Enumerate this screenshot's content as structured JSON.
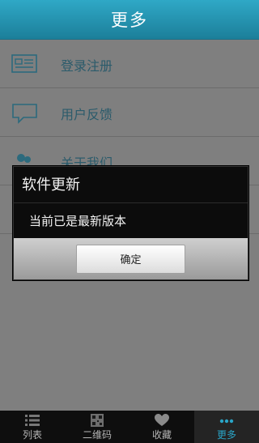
{
  "header": {
    "title": "更多"
  },
  "list": [
    {
      "label": "登录注册",
      "icon": "id-card-icon"
    },
    {
      "label": "用户反馈",
      "icon": "chat-bubble-icon"
    },
    {
      "label": "关于我们",
      "icon": "users-icon"
    },
    {
      "label": "",
      "icon": "info-icon"
    }
  ],
  "dialog": {
    "title": "软件更新",
    "message": "当前已是最新版本",
    "ok_label": "确定"
  },
  "tabbar": {
    "items": [
      {
        "label": "列表",
        "icon": "list-icon"
      },
      {
        "label": "二维码",
        "icon": "qr-code-icon"
      },
      {
        "label": "收藏",
        "icon": "heart-icon"
      },
      {
        "label": "更多",
        "icon": "more-dots-icon",
        "active": true
      }
    ]
  },
  "colors": {
    "accent": "#2aa5c7",
    "header": "#1c7f9a"
  }
}
